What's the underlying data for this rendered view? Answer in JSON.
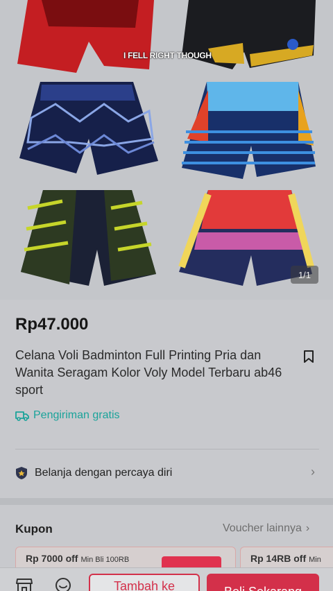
{
  "gallery": {
    "caption": "I FELL RIGHT THOUGH",
    "counter": "1/1"
  },
  "product": {
    "price": "Rp47.000",
    "title": "Celana Voli Badminton Full Printing Pria dan Wanita Seragam Kolor Voly Model Terbaru ab46 sport",
    "shipping_label": "Pengiriman gratis",
    "trust_label": "Belanja dengan percaya diri"
  },
  "coupons": {
    "title": "Kupon",
    "more_label": "Voucher lainnya",
    "items": [
      {
        "amount": "Rp 7000 off",
        "min": "Min Bli 100RB"
      },
      {
        "amount": "Rp 14RB off",
        "min": "Min"
      }
    ]
  },
  "bottom_bar": {
    "add_to_cart": "Tambah ke",
    "buy_now": "Beli Sekarang"
  },
  "colors": {
    "accent": "#d3304a",
    "shipping": "#1aa39a"
  },
  "icons": [
    "bookmark-icon",
    "truck-icon",
    "shield-icon",
    "chevron-right-icon",
    "store-icon",
    "chat-icon"
  ]
}
